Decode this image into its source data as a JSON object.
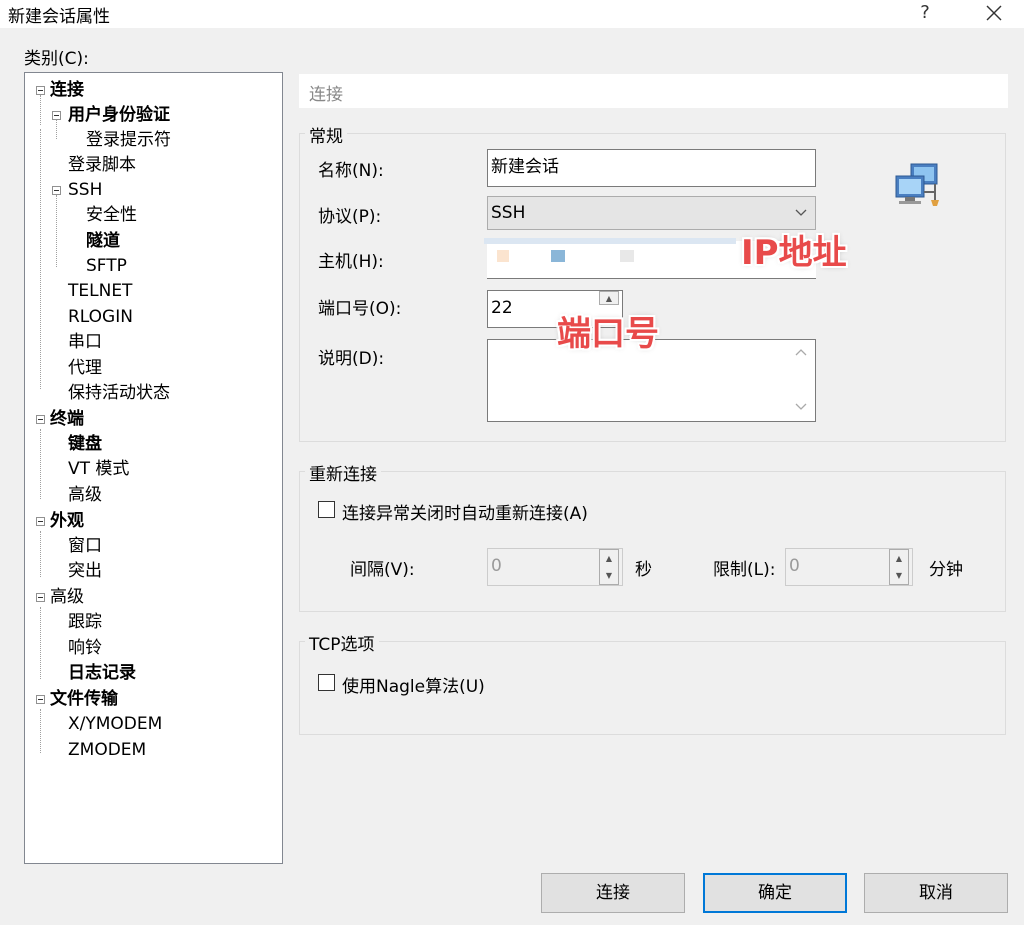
{
  "window": {
    "title": "新建会话属性",
    "help": "?",
    "close_label": "×"
  },
  "category_label": "类别(C):",
  "tree": {
    "items": [
      {
        "label": "连接",
        "bold": true
      },
      {
        "label": "用户身份验证",
        "bold": true
      },
      {
        "label": "登录提示符",
        "bold": false
      },
      {
        "label": "登录脚本",
        "bold": false
      },
      {
        "label": "SSH",
        "bold": false
      },
      {
        "label": "安全性",
        "bold": false
      },
      {
        "label": "隧道",
        "bold": true
      },
      {
        "label": "SFTP",
        "bold": false
      },
      {
        "label": "TELNET",
        "bold": false
      },
      {
        "label": "RLOGIN",
        "bold": false
      },
      {
        "label": "串口",
        "bold": false
      },
      {
        "label": "代理",
        "bold": false
      },
      {
        "label": "保持活动状态",
        "bold": false
      },
      {
        "label": "终端",
        "bold": true
      },
      {
        "label": "键盘",
        "bold": true
      },
      {
        "label": "VT 模式",
        "bold": false
      },
      {
        "label": "高级",
        "bold": false
      },
      {
        "label": "外观",
        "bold": true
      },
      {
        "label": "窗口",
        "bold": false
      },
      {
        "label": "突出",
        "bold": false
      },
      {
        "label": "高级",
        "bold": false
      },
      {
        "label": "跟踪",
        "bold": false
      },
      {
        "label": "响铃",
        "bold": false
      },
      {
        "label": "日志记录",
        "bold": true
      },
      {
        "label": "文件传输",
        "bold": true
      },
      {
        "label": "X/YMODEM",
        "bold": false
      },
      {
        "label": "ZMODEM",
        "bold": false
      }
    ]
  },
  "panel": {
    "header": "连接",
    "general": {
      "title": "常规",
      "name_label": "名称(N):",
      "name_value": "新建会话",
      "protocol_label": "协议(P):",
      "protocol_value": "SSH",
      "host_label": "主机(H):",
      "host_value": "",
      "port_label": "端口号(O):",
      "port_value": "22",
      "desc_label": "说明(D):",
      "desc_value": ""
    },
    "reconnect": {
      "title": "重新连接",
      "checkbox_label": "连接异常关闭时自动重新连接(A)",
      "interval_label": "间隔(V):",
      "interval_value": "0",
      "interval_unit": "秒",
      "limit_label": "限制(L):",
      "limit_value": "0",
      "limit_unit": "分钟"
    },
    "tcp": {
      "title": "TCP选项",
      "nagle_label": "使用Nagle算法(U)"
    }
  },
  "annotations": {
    "ip": "IP地址",
    "port": "端口号"
  },
  "buttons": {
    "connect": "连接",
    "ok": "确定",
    "cancel": "取消"
  },
  "colors": {
    "annotation": "#e84a4a",
    "default_button_border": "#0078d7"
  }
}
